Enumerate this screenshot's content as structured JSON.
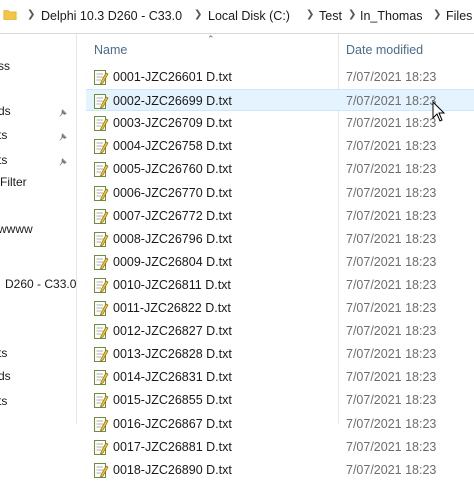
{
  "breadcrumb": [
    "Delphi 10.3 D260 - C33.0",
    "Local Disk (C:)",
    "Test",
    "In_Thomas",
    "Files"
  ],
  "columns": {
    "name": "Name",
    "date": "Date modified"
  },
  "nav": [
    {
      "label": "ss",
      "pinned": false
    },
    {
      "label": "ds",
      "pinned": true
    },
    {
      "label": "ts",
      "pinned": true
    },
    {
      "label": "ts",
      "pinned": true
    },
    {
      "label": "Filter",
      "pinned": false
    },
    {
      "label": "wwww",
      "pinned": false
    },
    {
      "label": "D260 - C33.0",
      "pinned": false
    },
    {
      "label": "ts",
      "pinned": false
    },
    {
      "label": "ds",
      "pinned": false
    },
    {
      "label": "ts",
      "pinned": false
    }
  ],
  "files": [
    {
      "name": "0001-JZC26601  D.txt",
      "date": "7/07/2021 18:23"
    },
    {
      "name": "0002-JZC26699  D.txt",
      "date": "7/07/2021 18:23"
    },
    {
      "name": "0003-JZC26709  D.txt",
      "date": "7/07/2021 18:23"
    },
    {
      "name": "0004-JZC26758  D.txt",
      "date": "7/07/2021 18:23"
    },
    {
      "name": "0005-JZC26760  D.txt",
      "date": "7/07/2021 18:23"
    },
    {
      "name": "0006-JZC26770  D.txt",
      "date": "7/07/2021 18:23"
    },
    {
      "name": "0007-JZC26772  D.txt",
      "date": "7/07/2021 18:23"
    },
    {
      "name": "0008-JZC26796  D.txt",
      "date": "7/07/2021 18:23"
    },
    {
      "name": "0009-JZC26804  D.txt",
      "date": "7/07/2021 18:23"
    },
    {
      "name": "0010-JZC26811  D.txt",
      "date": "7/07/2021 18:23"
    },
    {
      "name": "0011-JZC26822  D.txt",
      "date": "7/07/2021 18:23"
    },
    {
      "name": "0012-JZC26827  D.txt",
      "date": "7/07/2021 18:23"
    },
    {
      "name": "0013-JZC26828  D.txt",
      "date": "7/07/2021 18:23"
    },
    {
      "name": "0014-JZC26831  D.txt",
      "date": "7/07/2021 18:23"
    },
    {
      "name": "0015-JZC26855  D.txt",
      "date": "7/07/2021 18:23"
    },
    {
      "name": "0016-JZC26867  D.txt",
      "date": "7/07/2021 18:23"
    },
    {
      "name": "0017-JZC26881  D.txt",
      "date": "7/07/2021 18:23"
    },
    {
      "name": "0018-JZC26890  D.txt",
      "date": "7/07/2021 18:23"
    }
  ],
  "hover_row": 1,
  "icons": {
    "folder": "folder-icon",
    "file": "text-file-icon",
    "pin": "pin-icon",
    "cursor": "mouse-cursor-icon",
    "chevron": "chevron-right-icon",
    "sort": "sort-up-icon"
  }
}
